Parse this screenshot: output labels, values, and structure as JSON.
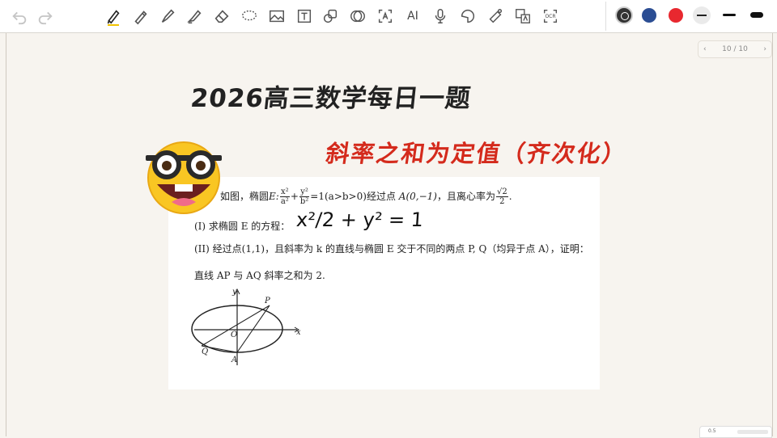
{
  "toolbar": {
    "tools": [
      "undo-icon",
      "redo-icon",
      "pen-icon",
      "pencil-icon",
      "fountain-pen-icon",
      "highlighter-icon",
      "eraser-icon",
      "lasso-icon",
      "image-icon",
      "text-box-icon",
      "shape-icon",
      "sticker-icon",
      "text-recognition-icon",
      "ai-icon",
      "microphone-icon",
      "sticky-note-icon",
      "laser-pointer-icon",
      "translate-icon",
      "ocr-icon"
    ],
    "ai_label": "AI",
    "ocr_label": "OCR",
    "colors": [
      "#333333",
      "#2b4d93",
      "#e8282f"
    ],
    "line_sizes": [
      "thin",
      "medium",
      "thick"
    ]
  },
  "pager": {
    "prev": "‹",
    "page": "10 / 10",
    "next": "›"
  },
  "note": {
    "title": "2026高三数学每日一题",
    "subtitle": "斜率之和为定值（齐次化）",
    "handwriting": "x²/2 + y² = 1"
  },
  "problem": {
    "intro_a": "如图，椭圆",
    "ellipse_var": "E:",
    "frac1_num": "x²",
    "frac1_den": "a²",
    "plus": "+",
    "frac2_num": "y²",
    "frac2_den": "b²",
    "eq": "=1(a>b>0)",
    "intro_b": "经过点",
    "point_a": "A(0,−1)",
    "intro_c": "，且离心率为",
    "frac3_num": "√2",
    "frac3_den": "2",
    "period": ".",
    "part1": "(I)  求椭圆 E 的方程：",
    "part2": "(II) 经过点(1,1)，且斜率为 k 的直线与椭圆 E 交于不同的两点 P, Q（均异于点 A），证明：",
    "part2_cont": "直线 AP 与 AQ 斜率之和为 2."
  },
  "figure": {
    "labels": [
      "y",
      "x",
      "O",
      "P",
      "Q",
      "A"
    ]
  },
  "mini_panel": {
    "label": "0.5"
  }
}
